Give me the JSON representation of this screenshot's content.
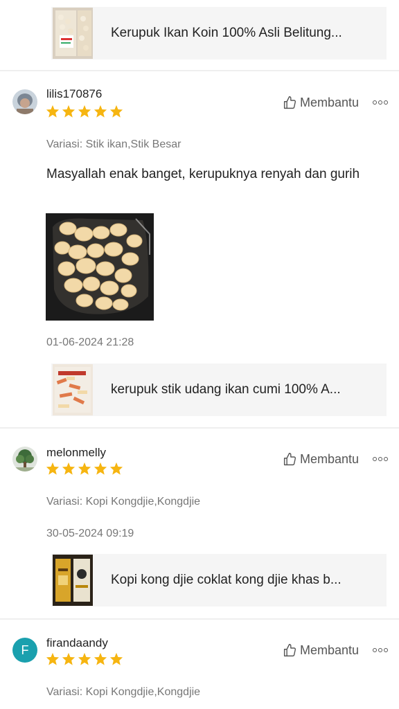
{
  "products": [
    {
      "title": "Kerupuk Ikan Koin 100% Asli Belitung...",
      "thumb_icon": "crackers-bag-thumb"
    },
    {
      "title": "kerupuk stik udang ikan cumi 100% A...",
      "thumb_icon": "shrimp-stick-thumb"
    },
    {
      "title": "Kopi kong djie coklat kong djie khas b...",
      "thumb_icon": "coffee-pack-thumb"
    }
  ],
  "reviews": [
    {
      "username": "lilis170876",
      "rating": 5,
      "helpful_label": "Membantu",
      "variant": "Variasi: Stik ikan,Stik Besar",
      "comment": "Masyallah enak banget, kerupuknya renyah dan gurih",
      "date": "01-06-2024 21:28"
    },
    {
      "username": "melonmelly",
      "rating": 5,
      "helpful_label": "Membantu",
      "variant": "Variasi: Kopi Kongdjie,Kongdjie",
      "date": "30-05-2024 09:19"
    },
    {
      "username": "firandaandy",
      "avatar_letter": "F",
      "rating": 5,
      "helpful_label": "Membantu",
      "variant": "Variasi: Kopi Kongdjie,Kongdjie"
    }
  ],
  "colors": {
    "star": "#f6b511",
    "avatar_f": "#1aa0ae",
    "card_bg": "#f5f5f5",
    "muted_text": "#777777"
  }
}
